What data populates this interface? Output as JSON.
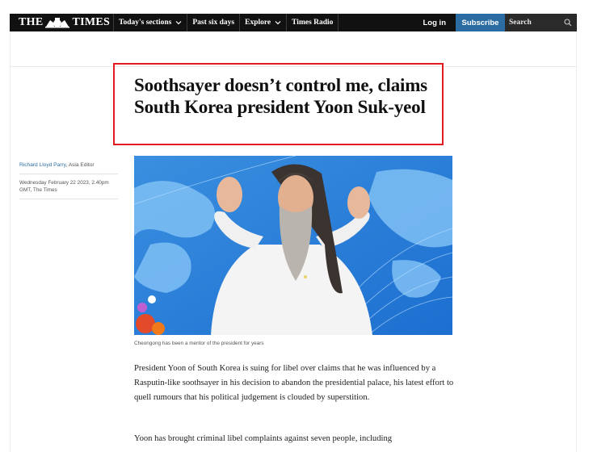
{
  "header": {
    "logo_text_left": "THE",
    "logo_text_right": "TIMES",
    "logo_crest_icon": "royal-crest-icon",
    "nav": [
      {
        "label": "Today's sections",
        "has_dropdown": true
      },
      {
        "label": "Past six days",
        "has_dropdown": false
      },
      {
        "label": "Explore",
        "has_dropdown": true
      },
      {
        "label": "Times Radio",
        "has_dropdown": false
      }
    ],
    "login_label": "Log in",
    "subscribe_label": "Subscribe",
    "search_placeholder": "Search",
    "search_icon": "search-icon"
  },
  "article": {
    "headline": "Soothsayer doesn’t control me, claims South Korea president Yoon Suk-yeol",
    "author_name": "Richard Lloyd Parry",
    "author_role": ", Asia Editor",
    "date": "Wednesday February 22 2023, 2.40pm GMT, The Times",
    "image_caption": "Cheongong has been a mentor of the president for years",
    "paragraphs": [
      "President Yoon of South Korea is suing for libel over claims that he was influenced by a Rasputin-like soothsayer in his decision to abandon the presidential palace, his latest effort to quell rumours that his political judgement is clouded by superstition.",
      "Yoon has brought criminal libel complaints against seven people, including"
    ]
  },
  "colors": {
    "nav_background": "#111111",
    "subscribe_background": "#2b6ca3",
    "highlight_border": "#e21b23",
    "link": "#2b6ca3"
  }
}
